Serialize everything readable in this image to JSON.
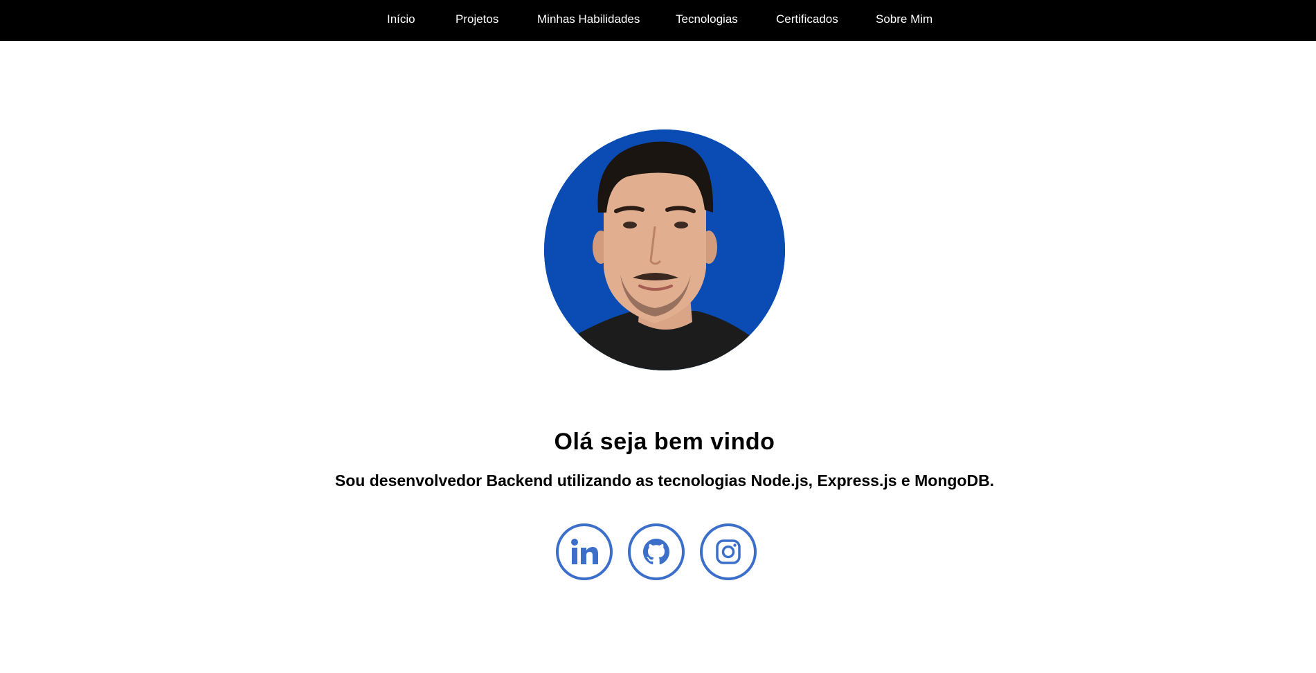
{
  "nav": {
    "items": [
      {
        "label": "Início"
      },
      {
        "label": "Projetos"
      },
      {
        "label": "Minhas Habilidades"
      },
      {
        "label": "Tecnologias"
      },
      {
        "label": "Certificados"
      },
      {
        "label": "Sobre Mim"
      }
    ]
  },
  "hero": {
    "title": "Olá seja bem vindo",
    "subtitle": "Sou desenvolvedor Backend utilizando as tecnologias Node.js, Express.js e MongoDB.",
    "photo_bg_color": "#0a4cb4"
  },
  "social": {
    "icon_color": "#3b6fc9",
    "links": [
      {
        "icon": "linkedin-icon"
      },
      {
        "icon": "github-icon"
      },
      {
        "icon": "instagram-icon"
      }
    ]
  },
  "theme": {
    "navbar_bg": "#000000",
    "nav_text": "#ffffff",
    "page_bg": "#ffffff"
  }
}
